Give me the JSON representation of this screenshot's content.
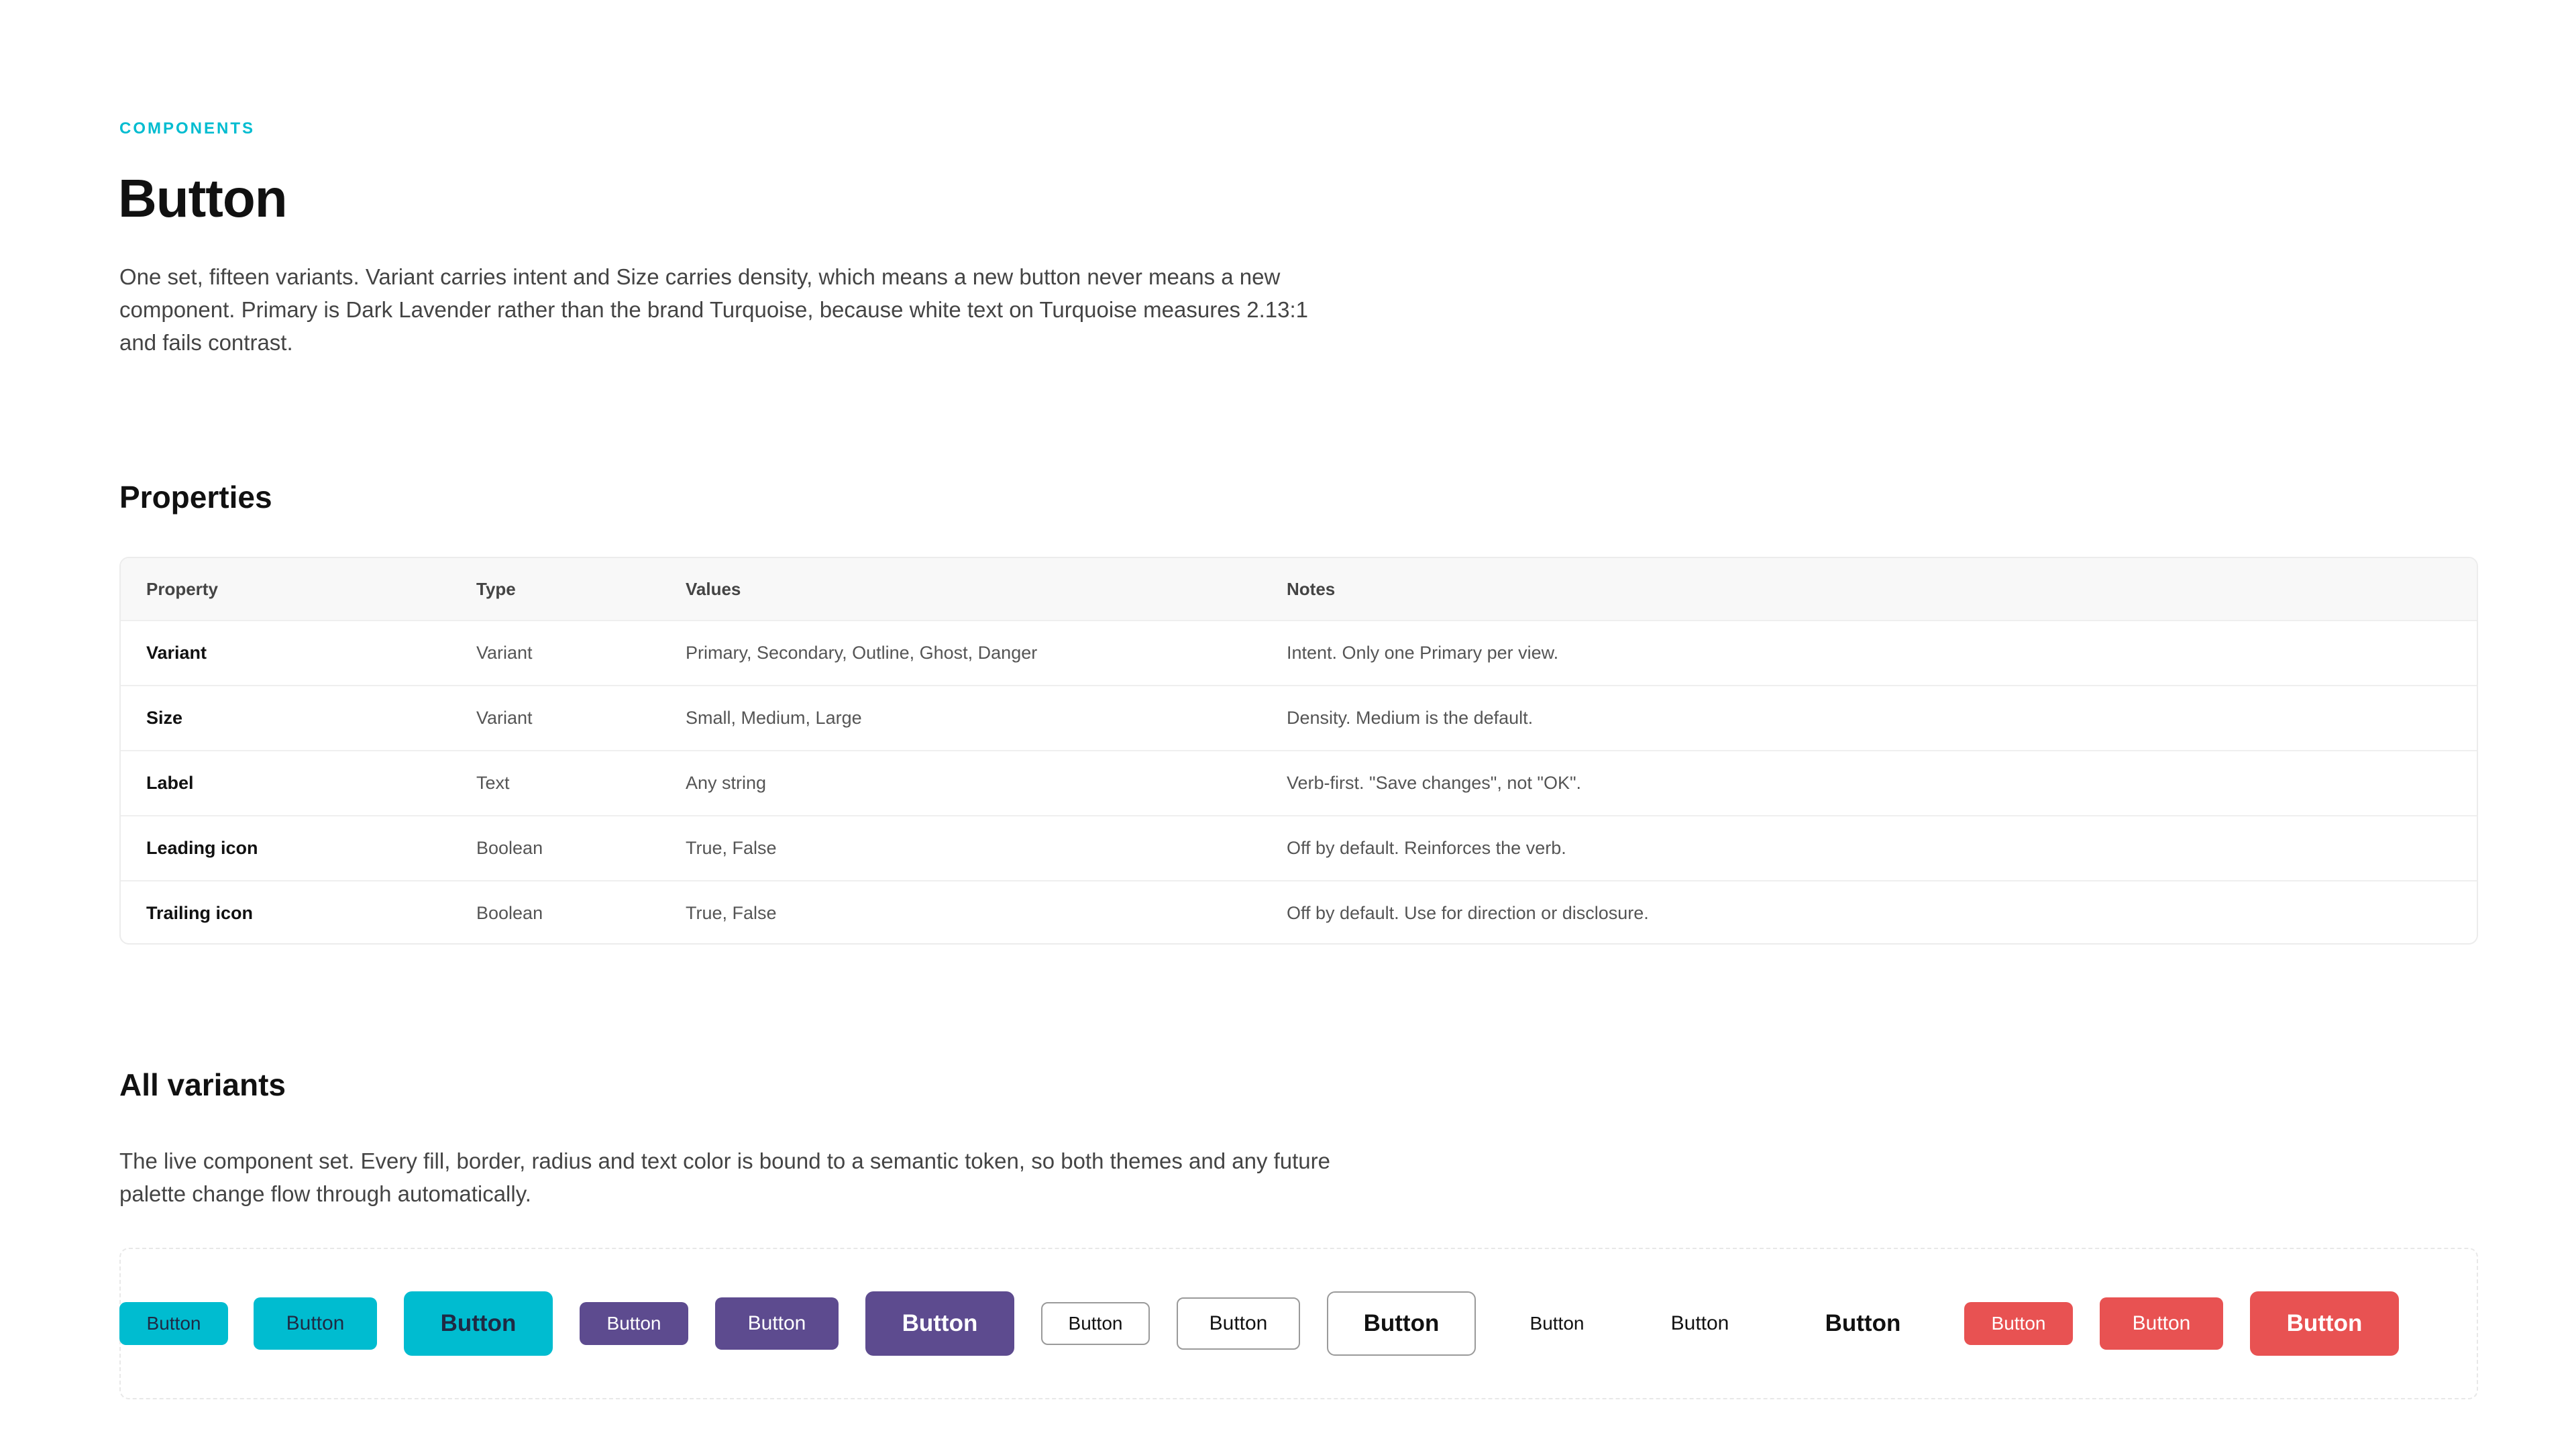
{
  "header": {
    "eyebrow": "COMPONENTS",
    "title": "Button",
    "description": "One set, fifteen variants. Variant carries intent and Size carries density, which means a new button never means a new component. Primary is Dark Lavender rather than the brand Turquoise, because white text on Turquoise measures 2.13:1 and fails contrast."
  },
  "properties": {
    "heading": "Properties",
    "columns": [
      "Property",
      "Type",
      "Values",
      "Notes"
    ],
    "rows": [
      [
        "Variant",
        "Variant",
        "Primary, Secondary, Outline, Ghost, Danger",
        "Intent. Only one Primary per view."
      ],
      [
        "Size",
        "Variant",
        "Small, Medium, Large",
        "Density. Medium is the default."
      ],
      [
        "Label",
        "Text",
        "Any string",
        "Verb-first. \"Save changes\", not \"OK\"."
      ],
      [
        "Leading icon",
        "Boolean",
        "True, False",
        "Off by default. Reinforces the verb."
      ],
      [
        "Trailing icon",
        "Boolean",
        "True, False",
        "Off by default. Use for direction or disclosure."
      ]
    ]
  },
  "variants": {
    "heading": "All variants",
    "description": "The live component set. Every fill, border, radius and text color is bound to a semantic token, so both themes and any future palette change flow through automatically.",
    "buttons": [
      {
        "variant": "primary",
        "size": "small",
        "label": "Button"
      },
      {
        "variant": "primary",
        "size": "medium",
        "label": "Button"
      },
      {
        "variant": "primary",
        "size": "large",
        "label": "Button"
      },
      {
        "variant": "secondary",
        "size": "small",
        "label": "Button"
      },
      {
        "variant": "secondary",
        "size": "medium",
        "label": "Button"
      },
      {
        "variant": "secondary",
        "size": "large",
        "label": "Button"
      },
      {
        "variant": "outline",
        "size": "small",
        "label": "Button"
      },
      {
        "variant": "outline",
        "size": "medium",
        "label": "Button"
      },
      {
        "variant": "outline",
        "size": "large",
        "label": "Button"
      },
      {
        "variant": "ghost",
        "size": "small",
        "label": "Button"
      },
      {
        "variant": "ghost",
        "size": "medium",
        "label": "Button"
      },
      {
        "variant": "ghost",
        "size": "large",
        "label": "Button"
      },
      {
        "variant": "danger",
        "size": "small",
        "label": "Button"
      },
      {
        "variant": "danger",
        "size": "medium",
        "label": "Button"
      },
      {
        "variant": "danger",
        "size": "large",
        "label": "Button"
      }
    ]
  },
  "colors": {
    "accent_turquoise": "#00bcd0",
    "dark_lavender": "#5d4b8f",
    "danger_red": "#e85252",
    "text_primary": "#111111",
    "text_secondary": "#444444"
  }
}
